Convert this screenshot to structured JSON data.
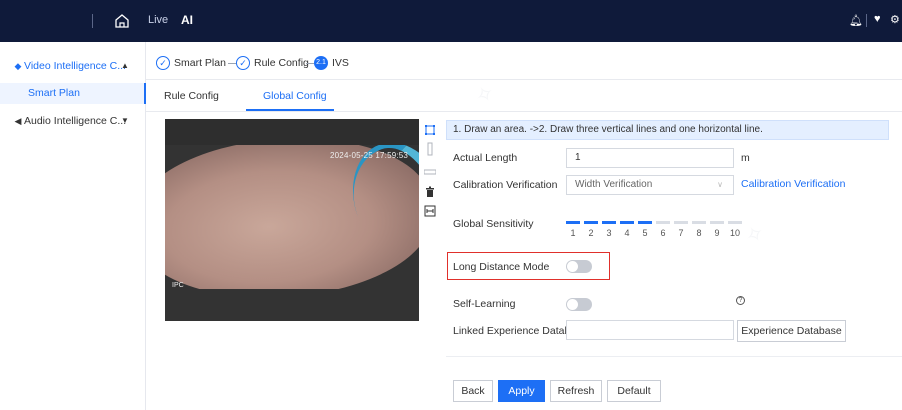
{
  "topbar": {
    "nav_live": "Live",
    "nav_ai": "AI"
  },
  "sidebar": {
    "items": [
      {
        "label": "Video Intelligence C...",
        "icon": "video-intelligence-icon",
        "expanded": true
      },
      {
        "label": "Smart Plan",
        "selected": true
      },
      {
        "label": "Audio Intelligence C...",
        "icon": "speaker-icon",
        "expanded": false
      }
    ]
  },
  "steps": {
    "items": [
      {
        "label": "Smart Plan",
        "state": "done"
      },
      {
        "label": "Rule Config",
        "state": "done"
      },
      {
        "label": "IVS",
        "number": "2.1",
        "state": "current"
      }
    ]
  },
  "tabs": [
    {
      "label": "Rule Config",
      "active": false
    },
    {
      "label": "Global Config",
      "active": true
    }
  ],
  "video": {
    "timestamp": "2024-05-25 17:59:53",
    "channel": "IPC"
  },
  "form": {
    "hint": "1. Draw an area. ->2. Draw three vertical lines and one horizontal line.",
    "actual_length": {
      "label": "Actual Length",
      "value": "1",
      "unit": "m"
    },
    "calibration": {
      "label": "Calibration Verification",
      "select_value": "Width Verification",
      "link": "Calibration Verification"
    },
    "sensitivity": {
      "label": "Global Sensitivity",
      "value": 5,
      "max": 10,
      "scale": [
        "1",
        "2",
        "3",
        "4",
        "5",
        "6",
        "7",
        "8",
        "9",
        "10"
      ]
    },
    "long_distance": {
      "label": "Long Distance Mode",
      "enabled": false
    },
    "self_learning": {
      "label": "Self-Learning",
      "enabled": false
    },
    "linked_db": {
      "label": "Linked Experience Databa...",
      "value": "",
      "button": "Experience Database"
    }
  },
  "buttons": {
    "back": "Back",
    "apply": "Apply",
    "refresh": "Refresh",
    "default": "Default"
  },
  "colors": {
    "accent": "#1d6ff5",
    "topbar_bg": "#0f1a3a",
    "highlight_box": "#e0302b",
    "hint_bg": "#e4efff"
  }
}
